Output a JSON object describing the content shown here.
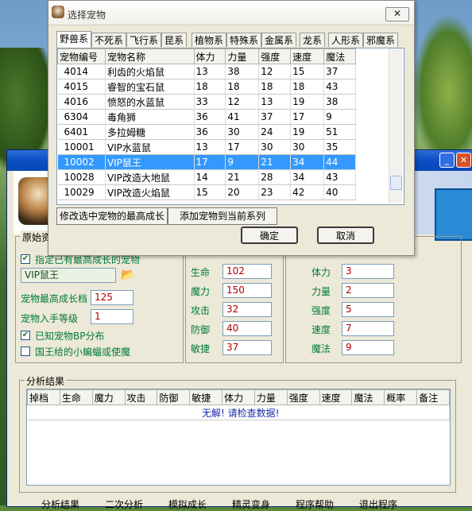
{
  "main": {
    "group_original": "原始资",
    "checkbox_prefer_label": "指定已有最高成长的宠物",
    "pet_name_value": "VIP鼠王",
    "max_growth_label": "宠物最高成长档",
    "max_growth_value": "125",
    "entry_level_label": "宠物入手等级",
    "entry_level_value": "1",
    "known_bp_label": "已知宠物BP分布",
    "king_label": "国王给的小蝙蝠或使魔",
    "stats_left": [
      {
        "label": "生命",
        "value": "102"
      },
      {
        "label": "魔力",
        "value": "150"
      },
      {
        "label": "攻击",
        "value": "32"
      },
      {
        "label": "防御",
        "value": "40"
      },
      {
        "label": "敏捷",
        "value": "37"
      }
    ],
    "stats_right": [
      {
        "label": "体力",
        "value": "3"
      },
      {
        "label": "力量",
        "value": "2"
      },
      {
        "label": "强度",
        "value": "5"
      },
      {
        "label": "速度",
        "value": "7"
      },
      {
        "label": "魔法",
        "value": "9"
      }
    ],
    "analysis_title": "分析结果",
    "analysis_headers": [
      "掉档",
      "生命",
      "魔力",
      "攻击",
      "防御",
      "敏捷",
      "体力",
      "力量",
      "强度",
      "速度",
      "魔法",
      "概率",
      "备注"
    ],
    "no_result_text": "无解! 请检查数据!",
    "footer_buttons": [
      "分析结果",
      "二次分析",
      "模拟成长",
      "精灵变身",
      "程序帮助",
      "退出程序"
    ]
  },
  "dialog": {
    "title": "选择宠物",
    "close_glyph": "✕",
    "tabs": [
      "野兽系",
      "不死系",
      "飞行系",
      "昆系",
      "植物系",
      "特殊系",
      "金属系",
      "龙系",
      "人形系",
      "邪魔系"
    ],
    "active_tab": "野兽系",
    "columns": [
      "宠物编号",
      "宠物名称",
      "体力",
      "力量",
      "强度",
      "速度",
      "魔法"
    ],
    "rows": [
      [
        "4014",
        "利齿的火焰鼠",
        "13",
        "38",
        "12",
        "15",
        "37"
      ],
      [
        "4015",
        "睿智的宝石鼠",
        "18",
        "18",
        "18",
        "18",
        "43"
      ],
      [
        "4016",
        "愤怒的水蓝鼠",
        "33",
        "12",
        "13",
        "19",
        "38"
      ],
      [
        "6304",
        "毒角狮",
        "36",
        "41",
        "37",
        "17",
        "9"
      ],
      [
        "6401",
        "多拉姆糖",
        "36",
        "30",
        "24",
        "19",
        "51"
      ],
      [
        "10001",
        "VIP水蓝鼠",
        "13",
        "17",
        "30",
        "30",
        "35"
      ],
      [
        "10002",
        "VIP鼠王",
        "17",
        "9",
        "21",
        "34",
        "44"
      ],
      [
        "10028",
        "VIP改造大地鼠",
        "14",
        "21",
        "28",
        "34",
        "43"
      ],
      [
        "10029",
        "VIP改造火焰鼠",
        "15",
        "20",
        "23",
        "42",
        "40"
      ]
    ],
    "selected_row": "10002",
    "btn_modify": "修改选中宠物的最高成长",
    "btn_add": "添加宠物到当前系列",
    "btn_ok": "确定",
    "btn_cancel": "取消"
  }
}
